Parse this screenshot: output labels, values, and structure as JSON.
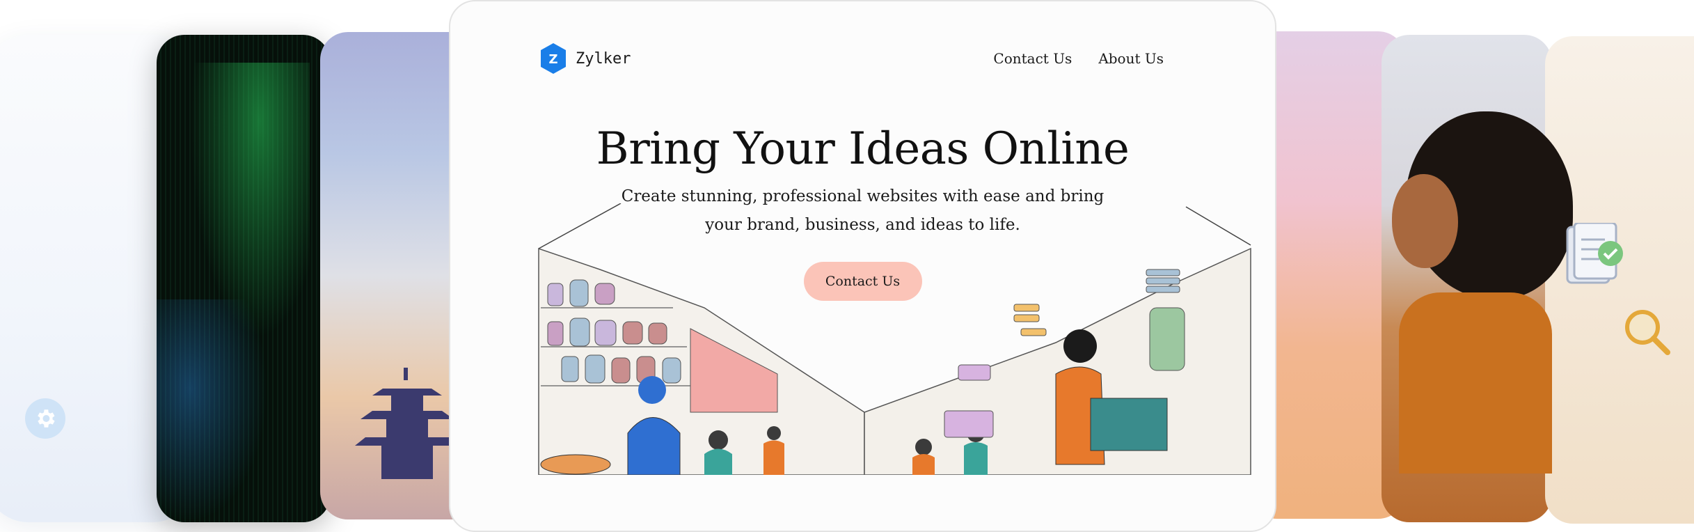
{
  "brand": {
    "name": "Zylker",
    "logo_letter": "Z",
    "logo_color": "#1a7ee8"
  },
  "nav": {
    "links": [
      "Contact Us",
      "About Us"
    ]
  },
  "hero": {
    "title": "Bring Your Ideas Online",
    "subtitle": "Create stunning, professional websites with ease and bring your brand, business, and ideas to life.",
    "cta_label": "Contact Us",
    "cta_color": "#fbc4b8"
  },
  "icons": [
    "gear-icon",
    "document-check-icon",
    "magnifier-icon"
  ]
}
